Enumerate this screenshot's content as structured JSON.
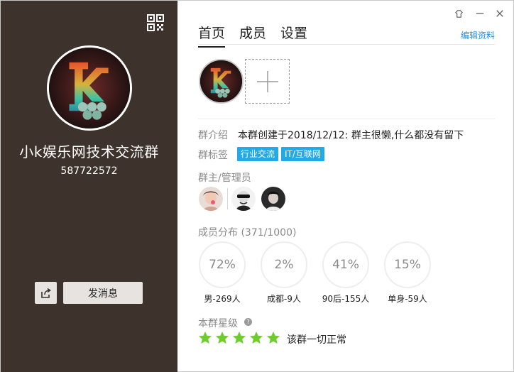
{
  "left_panel": {
    "group_name": "小k娱乐网技术交流群",
    "group_id": "587722572",
    "send_message_label": "发消息"
  },
  "tabs": [
    {
      "label": "首页",
      "active": true
    },
    {
      "label": "成员",
      "active": false
    },
    {
      "label": "设置",
      "active": false
    }
  ],
  "edit_profile_label": "编辑资料",
  "intro": {
    "label": "群介绍",
    "text": "本群创建于2018/12/12:  群主很懒,什么都没有留下"
  },
  "tags": {
    "label": "群标签",
    "items": [
      "行业交流",
      "IT/互联网"
    ]
  },
  "admins": {
    "label": "群主/管理员"
  },
  "distribution": {
    "label": "成员分布 (371/1000)",
    "stats": [
      {
        "percent": "72%",
        "caption": "男-269人"
      },
      {
        "percent": "2%",
        "caption": "成都-9人"
      },
      {
        "percent": "41%",
        "caption": "90后-155人"
      },
      {
        "percent": "15%",
        "caption": "单身-59人"
      }
    ]
  },
  "rating": {
    "label": "本群星级",
    "stars": 5,
    "status": "该群一切正常"
  },
  "icons": {
    "qr": "qr-code-icon",
    "skin": "skin-icon",
    "minimize": "minimize-icon",
    "close": "close-icon",
    "share": "share-icon",
    "add": "plus-icon",
    "help": "help-icon",
    "star": "star-icon"
  },
  "colors": {
    "left_panel_bg": "#3e322c",
    "accent_blue": "#1f8ee5",
    "tag_bg": "#22a9e6",
    "star_green": "#6fcd2b"
  }
}
